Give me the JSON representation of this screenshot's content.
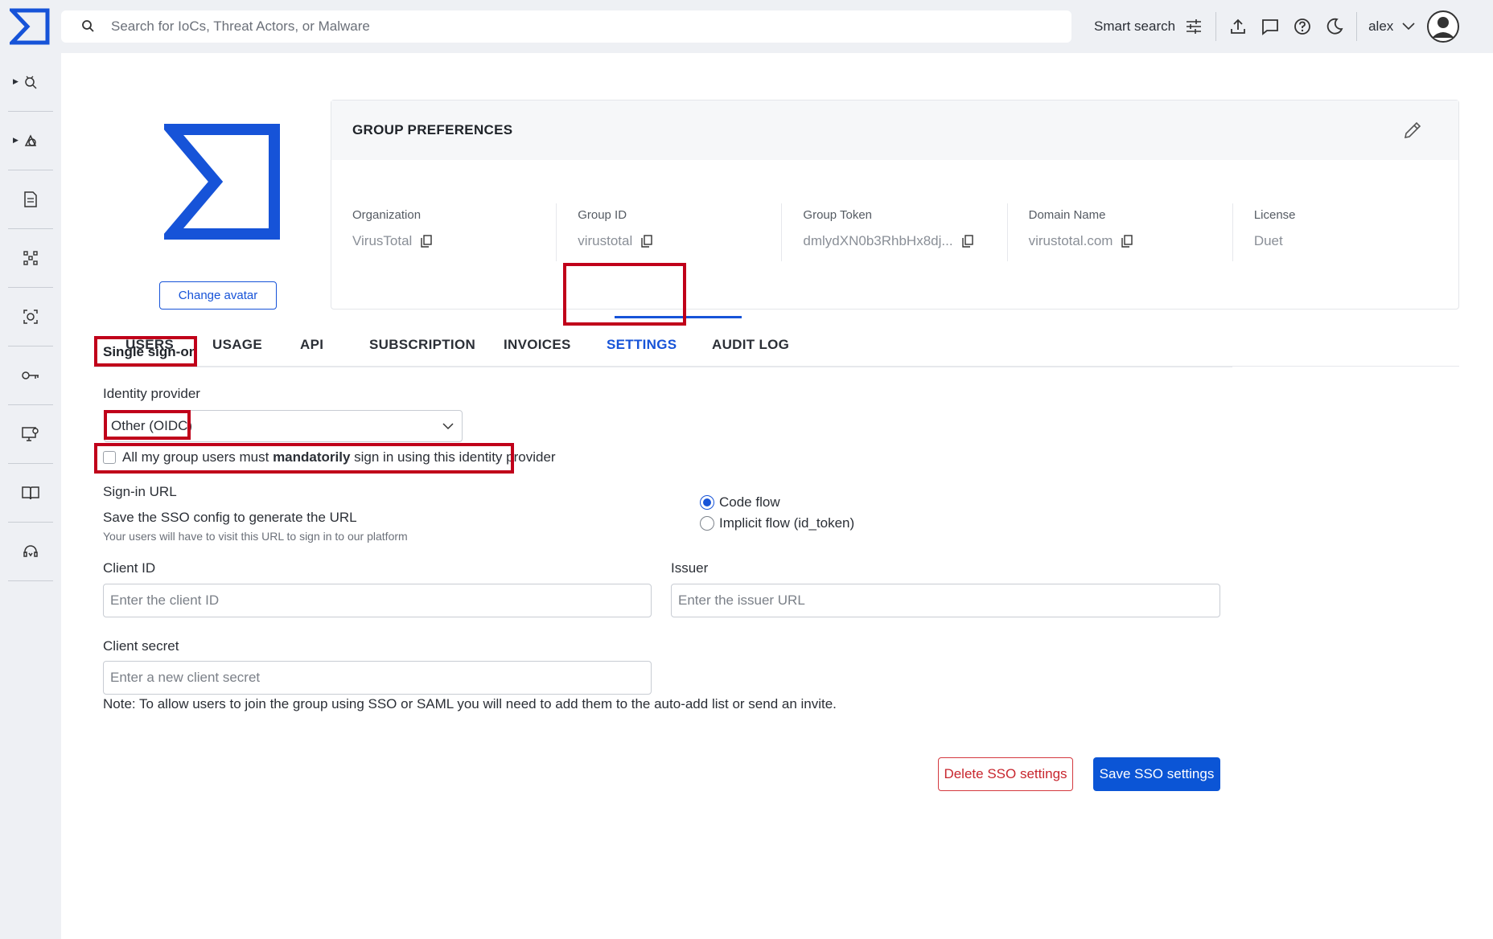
{
  "search": {
    "placeholder": "Search for IoCs, Threat Actors, or Malware"
  },
  "topbar": {
    "smart_search": "Smart search",
    "user": "alex"
  },
  "sidebar": {
    "icons": [
      "threat-hunt-icon",
      "threat-landscape-icon",
      "reports-icon",
      "graph-icon",
      "monitor-icon",
      "api-key-icon",
      "device-icon",
      "docs-icon",
      "support-icon"
    ]
  },
  "avatar": {
    "change_label": "Change avatar"
  },
  "prefs": {
    "title": "GROUP PREFERENCES",
    "fields": [
      {
        "label": "Organization",
        "value": "VirusTotal"
      },
      {
        "label": "Group ID",
        "value": "virustotal"
      },
      {
        "label": "Group Token",
        "value": "dmlydXN0b3RhbHx8dj..."
      },
      {
        "label": "Domain Name",
        "value": "virustotal.com"
      },
      {
        "label": "License",
        "value": "Duet"
      }
    ]
  },
  "tabs": [
    "USERS",
    "USAGE",
    "API",
    "SUBSCRIPTION",
    "INVOICES",
    "SETTINGS",
    "AUDIT LOG"
  ],
  "active_tab": "SETTINGS",
  "sso": {
    "title": "Single sign-on",
    "identity_provider_label": "Identity provider",
    "identity_provider_value": "Other (OIDC)",
    "mandatory_prefix": "All my group users must ",
    "mandatory_bold": "mandatorily",
    "mandatory_suffix": " sign in using this identity provider",
    "signin_url_label": "Sign-in URL",
    "signin_url_text": "Save the SSO config to generate the URL",
    "signin_url_hint": "Your users will have to visit this URL to sign in to our platform",
    "flow_options": [
      {
        "label": "Code flow",
        "selected": true
      },
      {
        "label": "Implicit flow (id_token)",
        "selected": false
      }
    ],
    "client_id_label": "Client ID",
    "client_id_placeholder": "Enter the client ID",
    "issuer_label": "Issuer",
    "issuer_placeholder": "Enter the issuer URL",
    "client_secret_label": "Client secret",
    "client_secret_placeholder": "Enter a new client secret",
    "note": "Note: To allow users to join the group using SSO or SAML you will need to add them to the auto-add list or send an invite.",
    "delete_label": "Delete SSO settings",
    "save_label": "Save SSO settings"
  },
  "colors": {
    "accent": "#1653d8",
    "highlight": "#c0001a",
    "danger": "#c8262e"
  }
}
